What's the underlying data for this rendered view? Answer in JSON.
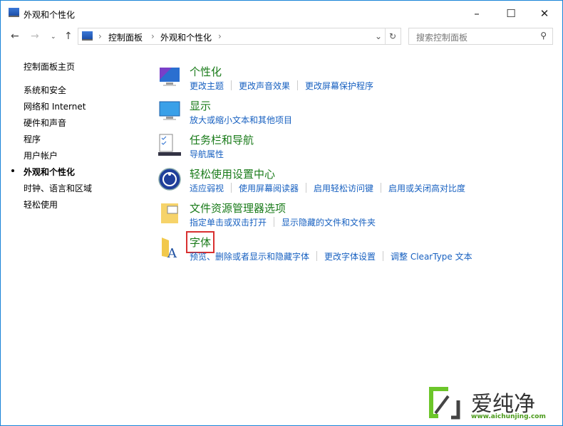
{
  "window": {
    "title": "外观和个性化",
    "minimize": "–",
    "maximize": "☐",
    "close": "✕"
  },
  "address": {
    "path": [
      "控制面板",
      "外观和个性化"
    ],
    "search_placeholder": "搜索控制面板"
  },
  "sidebar": {
    "items": [
      {
        "label": "控制面板主页"
      },
      {
        "label": "系统和安全"
      },
      {
        "label": "网络和 Internet"
      },
      {
        "label": "硬件和声音"
      },
      {
        "label": "程序"
      },
      {
        "label": "用户帐户"
      },
      {
        "label": "外观和个性化",
        "active": true
      },
      {
        "label": "时钟、语言和区域"
      },
      {
        "label": "轻松使用"
      }
    ]
  },
  "categories": [
    {
      "title": "个性化",
      "icon": "personalization-icon",
      "links": [
        "更改主题",
        "更改声音效果",
        "更改屏幕保护程序"
      ]
    },
    {
      "title": "显示",
      "icon": "display-icon",
      "links": [
        "放大或缩小文本和其他项目"
      ]
    },
    {
      "title": "任务栏和导航",
      "icon": "taskbar-icon",
      "links": [
        "导航属性"
      ]
    },
    {
      "title": "轻松使用设置中心",
      "icon": "ease-of-access-icon",
      "links": [
        "适应弱视",
        "使用屏幕阅读器",
        "启用轻松访问键",
        "启用或关闭高对比度"
      ]
    },
    {
      "title": "文件资源管理器选项",
      "icon": "folder-options-icon",
      "links": [
        "指定单击或双击打开",
        "显示隐藏的文件和文件夹"
      ]
    },
    {
      "title": "字体",
      "icon": "fonts-icon",
      "links": [
        "预览、删除或者显示和隐藏字体",
        "更改字体设置",
        "调整 ClearType 文本"
      ]
    }
  ],
  "watermark": {
    "name": "爱纯净",
    "url": "www.aichunjing.com"
  }
}
